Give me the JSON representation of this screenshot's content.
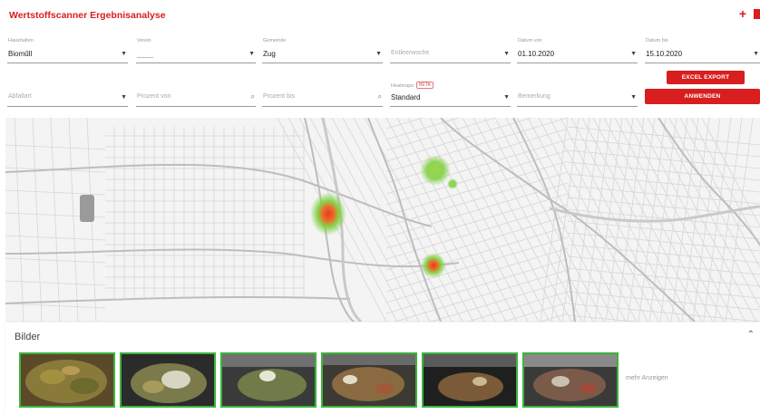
{
  "app": {
    "title": "Wertstoffscanner Ergebnisanalyse"
  },
  "header_icons": [
    "add-icon",
    "flag-icon"
  ],
  "filters": {
    "haushalten": {
      "label": "Haushalten",
      "value": "Bioműll"
    },
    "verein": {
      "label": "Verein",
      "value": "____"
    },
    "gemeinde": {
      "label": "Gemeinde",
      "value": "Zug"
    },
    "entleerung": {
      "label": "",
      "placeholder": "Entleerwoche"
    },
    "datum_von": {
      "label": "Datum von",
      "value": "01.10.2020"
    },
    "datum_bis": {
      "label": "Datum bis",
      "value": "15.10.2020"
    },
    "abfallart": {
      "label": "",
      "placeholder": "Abfallart"
    },
    "prozent_von": {
      "label": "",
      "placeholder": "Prozent von"
    },
    "prozent_bis": {
      "label": "",
      "placeholder": "Prozent bis"
    },
    "heatmap": {
      "label": "Heatmaps",
      "badge": "BETA",
      "value": "Standard"
    },
    "bemerkung": {
      "label": "",
      "placeholder": "Bemerkung"
    }
  },
  "buttons": {
    "excel_export": "EXCEL EXPORT",
    "apply": "ANWENDEN"
  },
  "colors": {
    "accent": "#d81e1e",
    "thumb_border": "#3cb43c",
    "heat_hot": "#e53a1f",
    "heat_cool": "#7ccf3c"
  },
  "images": {
    "title": "Bilder",
    "show_more": "mehr Anzeigen",
    "count": 6
  }
}
